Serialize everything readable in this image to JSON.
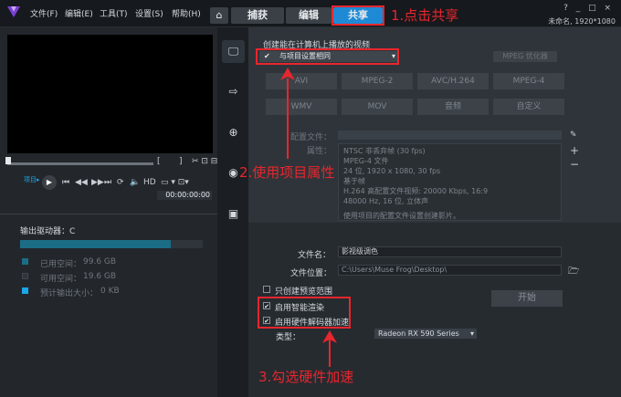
{
  "menu": {
    "file": "文件(F)",
    "edit": "编辑(E)",
    "tools": "工具(T)",
    "settings": "设置(S)",
    "help": "帮助(H)"
  },
  "tabs": {
    "capture": "捕获",
    "edit": "编辑",
    "share": "共享"
  },
  "annotations": {
    "step1": "1.点击共享",
    "step2": "2.使用项目属性",
    "step3": "3.勾选硬件加速"
  },
  "window": {
    "project_info": "未命名, 1920*1080",
    "controls": "? _ □ ×"
  },
  "player": {
    "project_label": "项目▸",
    "hd_label": "HD",
    "timecode": "00:00:00:00",
    "bracket_left": "[",
    "bracket_right": "]"
  },
  "storage": {
    "drive_label": "输出驱动器：C",
    "used_label": "已用空间：",
    "used_value": "99.6 GB",
    "free_label": "可用空间：",
    "free_value": "19.6 GB",
    "est_label": "预计输出大小：",
    "est_value": "0 KB"
  },
  "share": {
    "section_title": "创建能在计算机上播放的视频",
    "preset_value": "与项目设置相同",
    "mpeg_options": "MPEG 优化器",
    "formats_row1": [
      "AVI",
      "MPEG-2",
      "AVC/H.264",
      "MPEG-4"
    ],
    "formats_row2": [
      "WMV",
      "MOV",
      "音频",
      "自定义"
    ],
    "profile_label": "配置文件：",
    "properties_label": "属性：",
    "properties": [
      "NTSC 非丢弃帧 (30 fps)",
      "MPEG-4 文件",
      "24 位, 1920 x 1080, 30 fps",
      "基于帧",
      "H.264 高配置文件视频: 20000 Kbps, 16:9",
      "48000 Hz, 16 位, 立体声"
    ],
    "properties_note": "使用项目的配置文件设置创建影片。",
    "filename_label": "文件名：",
    "filename_value": "影视级调色",
    "location_label": "文件位置：",
    "location_value": "C:\\Users\\Muse Frog\\Desktop\\",
    "preview_only_label": "只创建预览范围",
    "smart_render_label": "启用智能渲染",
    "hw_accel_label": "启用硬件解码器加速",
    "type_label": "类型：",
    "gpu_value": "Radeon RX 590 Series",
    "start_label": "开始"
  },
  "colors": {
    "accent": "#1e8ad6",
    "annotation": "#e8262d",
    "used": "#1b6d86",
    "free": "#2f353b",
    "estimate": "#1aa6e8"
  }
}
